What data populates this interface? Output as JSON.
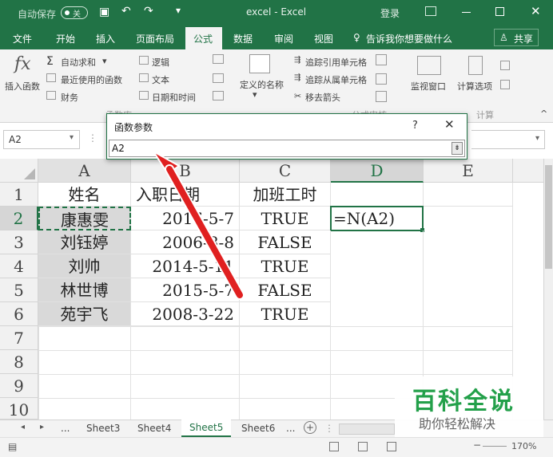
{
  "titlebar": {
    "autosave_label": "自动保存",
    "autosave_state": "关",
    "title": "excel  -  Excel",
    "login": "登录"
  },
  "ribbon_tabs": [
    "文件",
    "开始",
    "插入",
    "页面布局",
    "公式",
    "数据",
    "审阅",
    "视图"
  ],
  "tellme": "告诉我你想要做什么",
  "share": "共享",
  "ribbon": {
    "insert_function": "插入函数",
    "autosum": "自动求和",
    "recent": "最近使用的函数",
    "finance": "财务",
    "logic": "逻辑",
    "text": "文本",
    "datetime": "日期和时间",
    "defined_names": "定义的名称",
    "trace_precedents": "追踪引用单元格",
    "trace_dependents": "追踪从属单元格",
    "remove_arrows": "移去箭头",
    "watch": "监视窗口",
    "calc_options": "计算选项",
    "group_lib": "函数库",
    "group_audit": "公式审核",
    "group_calc": "计算"
  },
  "namebox": "A2",
  "dialog": {
    "title": "函数参数",
    "help": "?",
    "input": "A2"
  },
  "columns": [
    "A",
    "B",
    "C",
    "D",
    "E"
  ],
  "rows": [
    "1",
    "2",
    "3",
    "4",
    "5",
    "6",
    "7",
    "8",
    "9",
    "10"
  ],
  "cells": [
    [
      "姓名",
      "入职日期",
      "加班工时",
      "",
      ""
    ],
    [
      "康惠雯",
      "2016-5-7",
      "TRUE",
      "=N(A2)",
      ""
    ],
    [
      "刘钰婷",
      "2006-8-8",
      "FALSE",
      "",
      ""
    ],
    [
      "刘帅",
      "2014-5-11",
      "TRUE",
      "",
      ""
    ],
    [
      "林世博",
      "2015-5-7",
      "FALSE",
      "",
      ""
    ],
    [
      "苑宇飞",
      "2008-3-22",
      "TRUE",
      "",
      ""
    ]
  ],
  "sheet_tabs": [
    "...",
    "Sheet3",
    "Sheet4",
    "Sheet5",
    "Sheet6",
    "..."
  ],
  "active_sheet": "Sheet5",
  "zoom": "170%",
  "watermark": {
    "title": "百科全说",
    "subtitle": "助你轻松解决"
  },
  "colors": {
    "accent": "#217346",
    "arrow": "#e02020"
  }
}
